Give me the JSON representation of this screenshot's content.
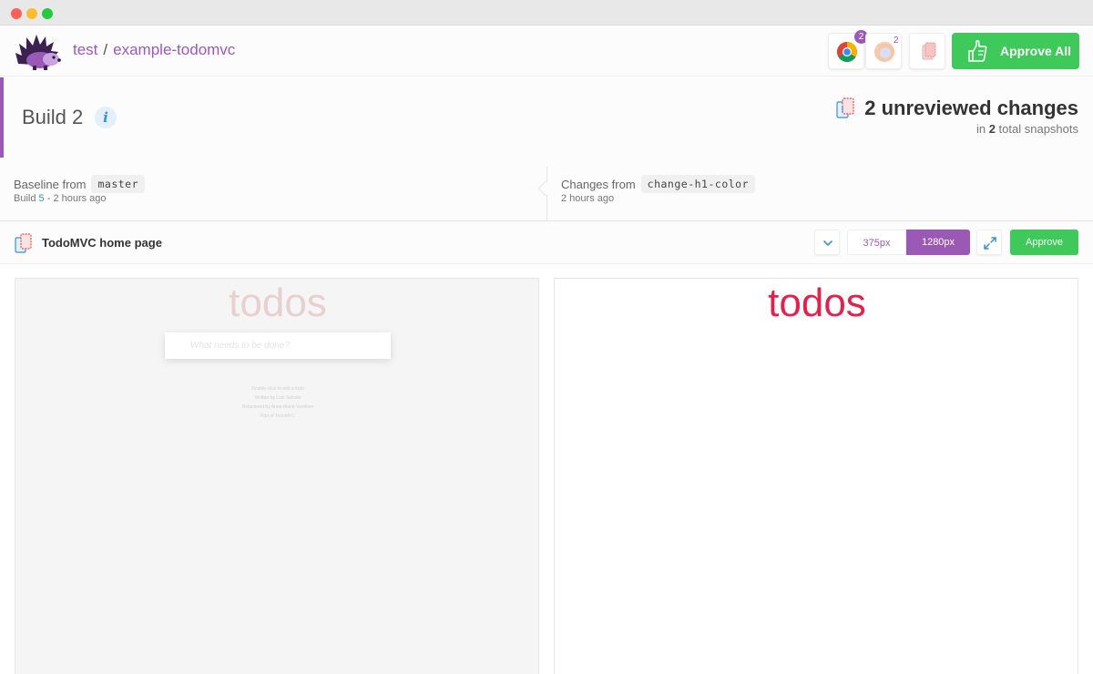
{
  "header": {
    "org": "test",
    "separator": "/",
    "project": "example-todomvc",
    "chrome_count": "2",
    "firefox_count": "2",
    "approve_all_label": "Approve All"
  },
  "build": {
    "title": "Build 2",
    "info_glyph": "i",
    "unreviewed": "2 unreviewed changes",
    "snapshot_prefix": "in",
    "snapshot_count": "2",
    "snapshot_suffix": "total snapshots"
  },
  "baseline": {
    "label": "Baseline from",
    "branch": "master",
    "build_prefix": "Build",
    "build_number": "5",
    "time": "- 2 hours ago"
  },
  "changes": {
    "label": "Changes from",
    "branch": "change-h1-color",
    "time": "2 hours ago"
  },
  "snapshot": {
    "name": "TodoMVC home page",
    "widths": [
      "375px",
      "1280px"
    ],
    "approve_label": "Approve"
  },
  "base_preview": {
    "heading": "todos",
    "placeholder": "What needs to be done?",
    "footer": [
      "Double-click to edit a todo",
      "Written by Luis Salvato",
      "Refactored by Anne-Marie Vandiver",
      "Part of TodoMVC"
    ]
  },
  "head_preview": {
    "heading": "todos"
  },
  "colors": {
    "brand": "#9b59b6",
    "approve": "#3ec95a",
    "changed_heading": "#e0234e"
  }
}
